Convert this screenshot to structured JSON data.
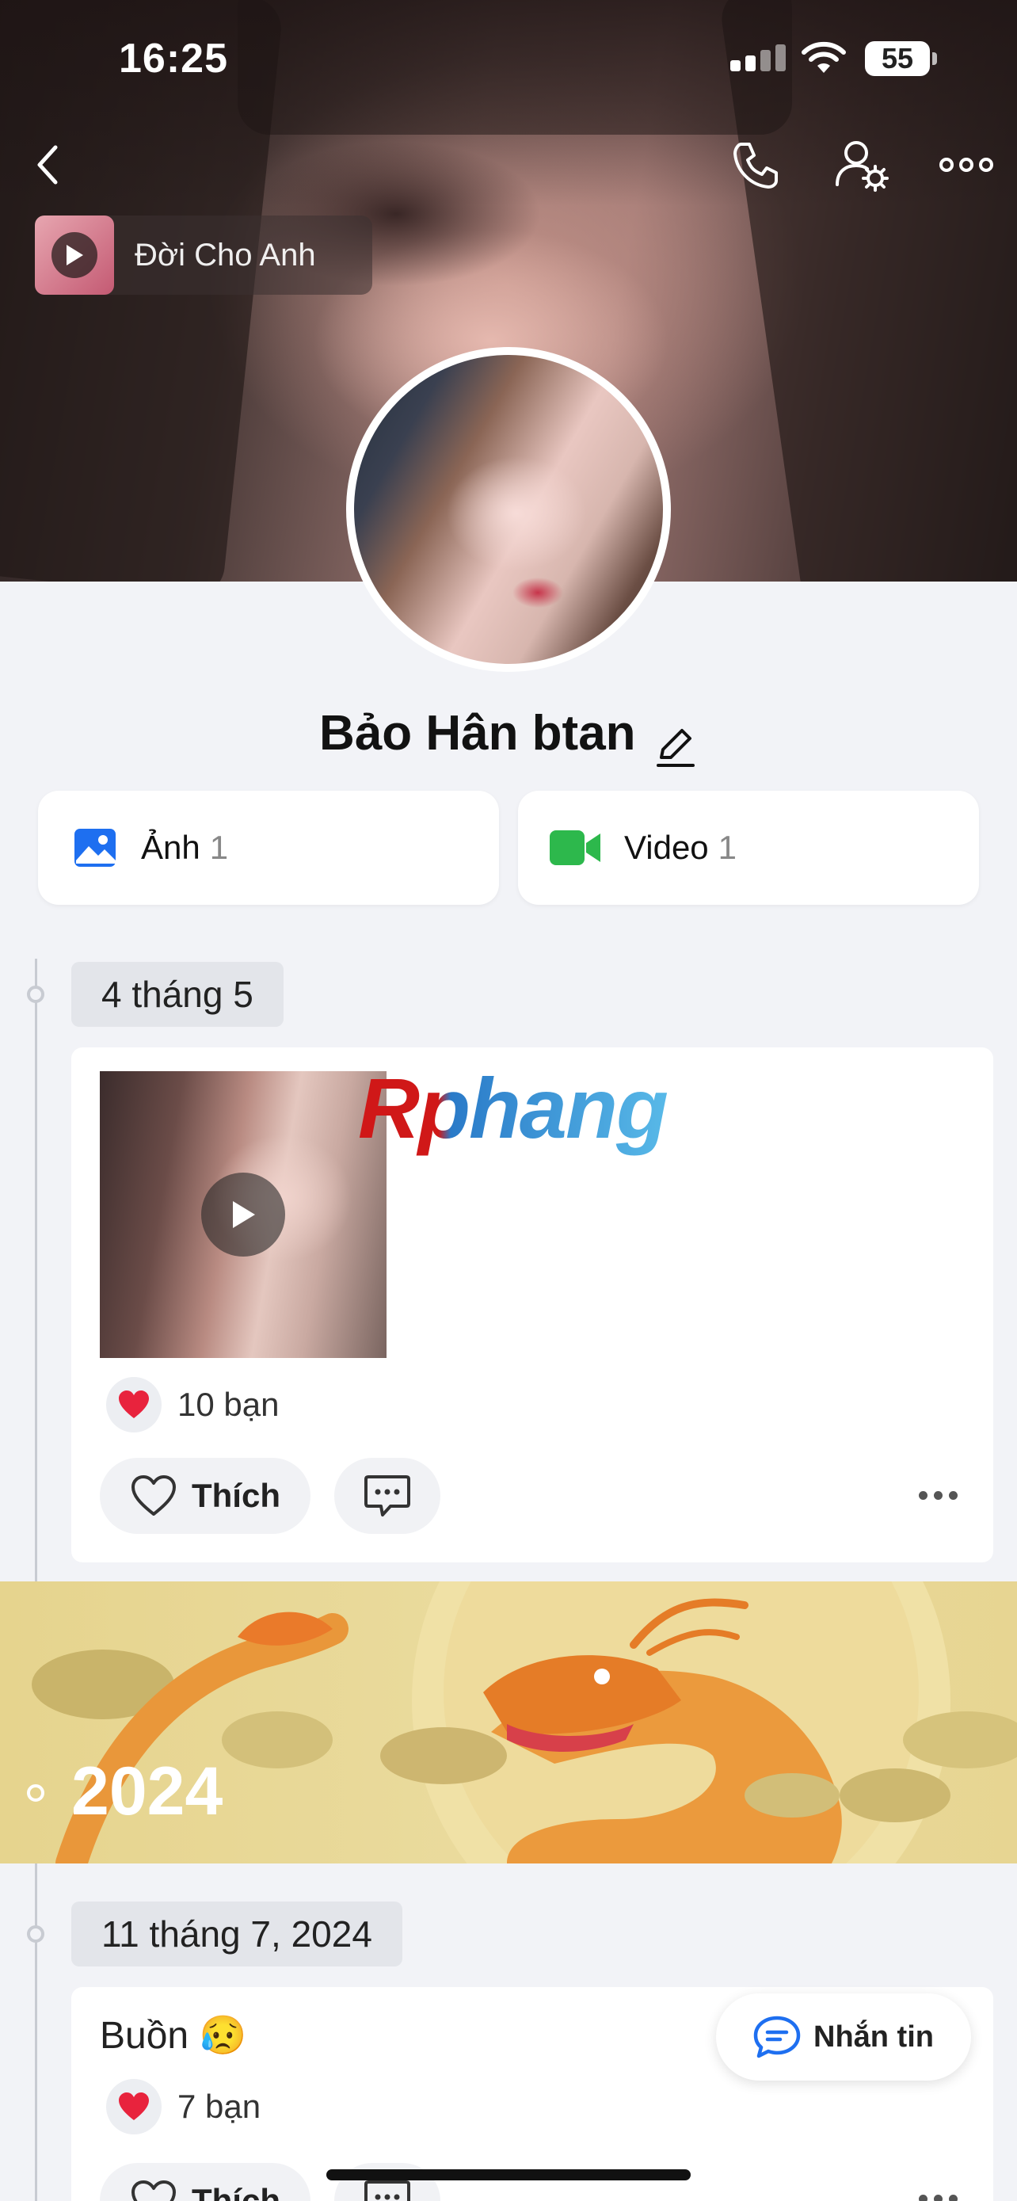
{
  "status_bar": {
    "time": "16:25",
    "battery": "55",
    "signal_icon": "signal-icon",
    "wifi_icon": "wifi-icon"
  },
  "top_nav": {
    "back_icon": "chevron-left-icon",
    "call_icon": "phone-icon",
    "profile_settings_icon": "user-gear-icon",
    "more_icon": "more-horizontal-icon"
  },
  "music": {
    "title": "Đời Cho Anh",
    "play_icon": "play-icon"
  },
  "profile": {
    "name": "Bảo Hân btan",
    "edit_icon": "pencil-icon"
  },
  "media": {
    "photos": {
      "label": "Ảnh",
      "count": "1",
      "icon": "image-icon",
      "color": "#1e6ff0"
    },
    "videos": {
      "label": "Video",
      "count": "1",
      "icon": "video-camera-icon",
      "color": "#2db84c"
    }
  },
  "timeline": {
    "post1": {
      "date": "4 tháng 5",
      "reaction_count": "10 bạn",
      "like_label": "Thích",
      "watermark": "Rphang"
    },
    "year_banner": {
      "year": "2024"
    },
    "post2": {
      "date": "11 tháng 7, 2024",
      "status": "Buồn 😥",
      "reaction_count": "7 bạn",
      "like_label": "Thích"
    }
  },
  "floating": {
    "message_label": "Nhắn tin",
    "message_icon": "chat-bubble-icon"
  },
  "colors": {
    "accent": "#1e6ff0",
    "heart": "#e8233d",
    "video_green": "#2db84c"
  }
}
